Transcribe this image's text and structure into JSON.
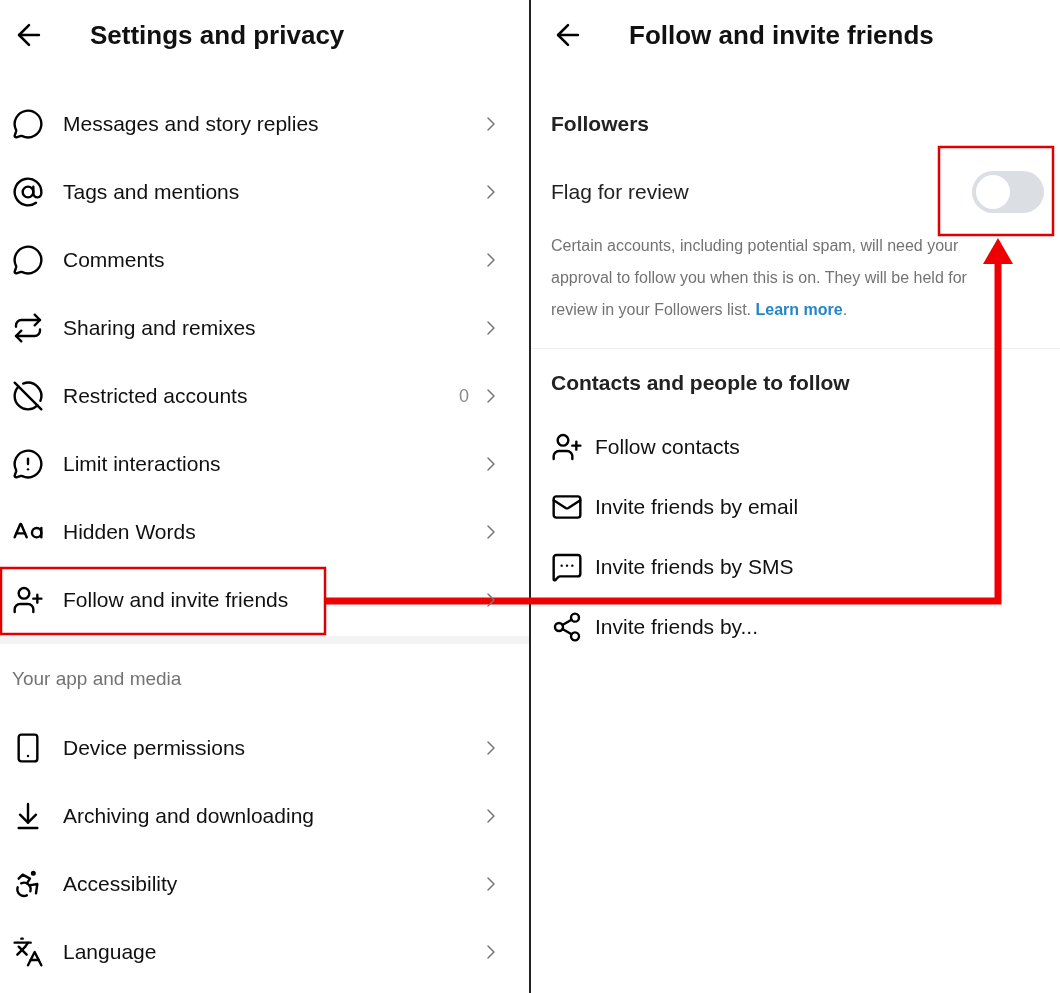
{
  "left_screen": {
    "title": "Settings and privacy",
    "items": [
      {
        "label": "Messages and story replies"
      },
      {
        "label": "Tags and mentions"
      },
      {
        "label": "Comments"
      },
      {
        "label": "Sharing and remixes"
      },
      {
        "label": "Restricted accounts",
        "count": "0"
      },
      {
        "label": "Limit interactions"
      },
      {
        "label": "Hidden Words"
      },
      {
        "label": "Follow and invite friends",
        "highlighted": true
      }
    ],
    "section": {
      "heading": "Your app and media",
      "items": [
        {
          "label": "Device permissions"
        },
        {
          "label": "Archiving and downloading"
        },
        {
          "label": "Accessibility"
        },
        {
          "label": "Language"
        }
      ]
    }
  },
  "right_screen": {
    "title": "Follow and invite friends",
    "followers": {
      "heading": "Followers",
      "toggle": {
        "label": "Flag for review",
        "on": false,
        "highlighted": true
      },
      "description": "Certain accounts, including potential spam, will need your approval to follow you when this is on. They will be held for review in your Followers list.",
      "link": "Learn more",
      "after_link": "."
    },
    "contacts": {
      "heading": "Contacts and people to follow",
      "items": [
        {
          "label": "Follow contacts"
        },
        {
          "label": "Invite friends by email"
        },
        {
          "label": "Invite friends by SMS"
        },
        {
          "label": "Invite friends by..."
        }
      ]
    }
  }
}
